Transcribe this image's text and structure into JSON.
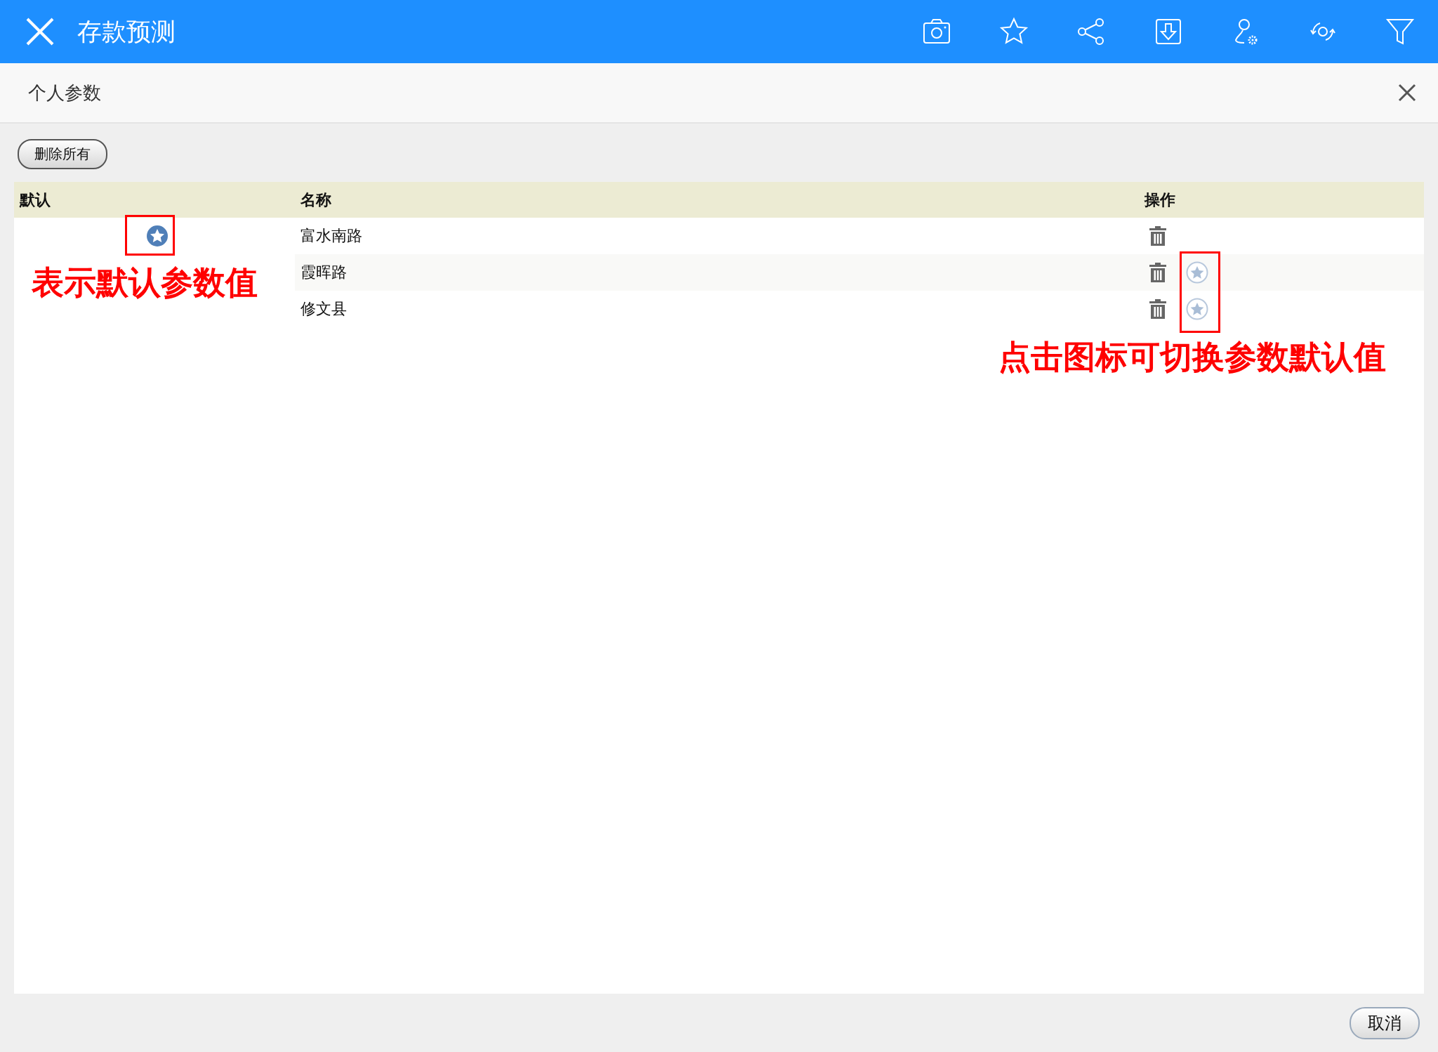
{
  "app_bar": {
    "title": "存款预测",
    "toolbar": [
      {
        "kind": "camera"
      },
      {
        "kind": "star"
      },
      {
        "kind": "share"
      },
      {
        "kind": "download"
      },
      {
        "kind": "usergear"
      },
      {
        "kind": "refresh"
      },
      {
        "kind": "filter"
      }
    ]
  },
  "dialog": {
    "title": "个人参数"
  },
  "delete_all_button": "删除所有",
  "table": {
    "columns": [
      "默认",
      "名称",
      "操作"
    ],
    "rows": [
      {
        "name": "富水南路",
        "default": true
      },
      {
        "name": "霞晖路",
        "default": false
      },
      {
        "name": "修文县",
        "default": false
      }
    ]
  },
  "annotations": [
    {
      "text": "表示默认参数值",
      "kind": "left"
    },
    {
      "text": "点击图标可切换参数默认值",
      "kind": "right"
    }
  ],
  "cancel_button": "取消"
}
